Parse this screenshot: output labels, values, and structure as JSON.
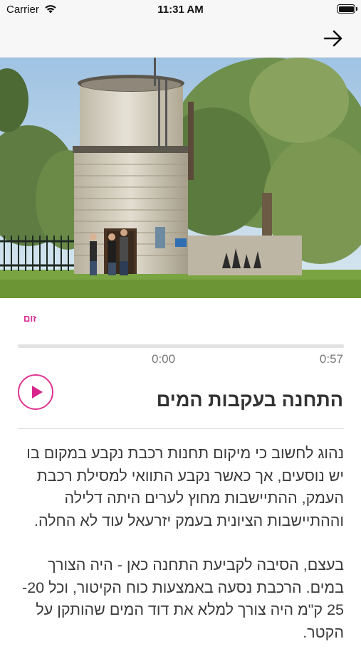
{
  "status_bar": {
    "carrier": "Carrier",
    "time": "11:31 AM"
  },
  "colors": {
    "accent": "#d8268c",
    "text": "#333333",
    "time_text": "#777777"
  },
  "nav": {
    "back_icon": "arrow-right-icon"
  },
  "hero": {
    "icon": "water-tower-photo"
  },
  "zoom": {
    "label": "זום"
  },
  "audio": {
    "current_time": "0:00",
    "total_time": "0:57",
    "progress": 0
  },
  "stop": {
    "title": "התחנה בעקבות המים"
  },
  "article": {
    "paragraphs": [
      "נהוג לחשוב כי מיקום תחנות רכבת נקבע במקום בו יש נוסעים, אך כאשר נקבע התוואי למסילת רכבת העמק, ההתיישבות מחוץ לערים היתה דלילה וההתיישבות הציונית בעמק יזרעאל עוד לא החלה.",
      "בעצם, הסיבה לקביעת התחנה כאן - היה הצורך במים. הרכבת נסעה באמצעות כוח הקיטור, וכל 20- 25 ק\"מ היה צורך למלא את דוד המים שהותקן על הקטר."
    ]
  }
}
